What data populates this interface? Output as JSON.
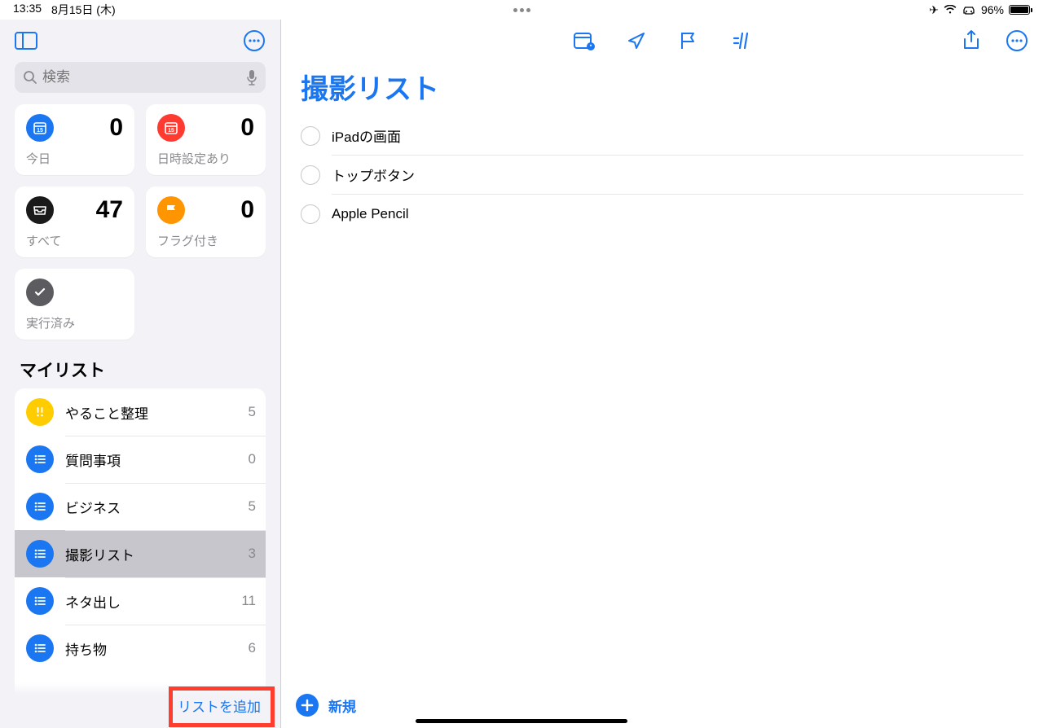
{
  "status": {
    "time": "13:35",
    "date": "8月15日 (木)",
    "battery": "96%"
  },
  "sidebar": {
    "search_placeholder": "検索",
    "smart": [
      {
        "label": "今日",
        "count": "0",
        "color": "#1b76f2",
        "icon": "calendar"
      },
      {
        "label": "日時設定あり",
        "count": "0",
        "color": "#ff3a30",
        "icon": "calendar"
      },
      {
        "label": "すべて",
        "count": "47",
        "color": "#1a1a1a",
        "icon": "inbox"
      },
      {
        "label": "フラグ付き",
        "count": "0",
        "color": "#ff9500",
        "icon": "flag"
      },
      {
        "label": "実行済み",
        "count": "",
        "color": "#5b5b60",
        "icon": "check"
      }
    ],
    "section_title": "マイリスト",
    "lists": [
      {
        "name": "やること整理",
        "count": "5",
        "color": "#ffcc00",
        "icon": "exclaim"
      },
      {
        "name": "質問事項",
        "count": "0",
        "color": "#1b76f2",
        "icon": "list"
      },
      {
        "name": "ビジネス",
        "count": "5",
        "color": "#1b76f2",
        "icon": "list"
      },
      {
        "name": "撮影リスト",
        "count": "3",
        "color": "#1b76f2",
        "icon": "list",
        "selected": true
      },
      {
        "name": "ネタ出し",
        "count": "11",
        "color": "#1b76f2",
        "icon": "list"
      },
      {
        "name": "持ち物",
        "count": "6",
        "color": "#1b76f2",
        "icon": "list"
      }
    ],
    "add_list_label": "リストを追加"
  },
  "main": {
    "title": "撮影リスト",
    "items": [
      {
        "text": "iPadの画面"
      },
      {
        "text": "トップボタン"
      },
      {
        "text": "Apple Pencil"
      }
    ],
    "new_label": "新規"
  }
}
